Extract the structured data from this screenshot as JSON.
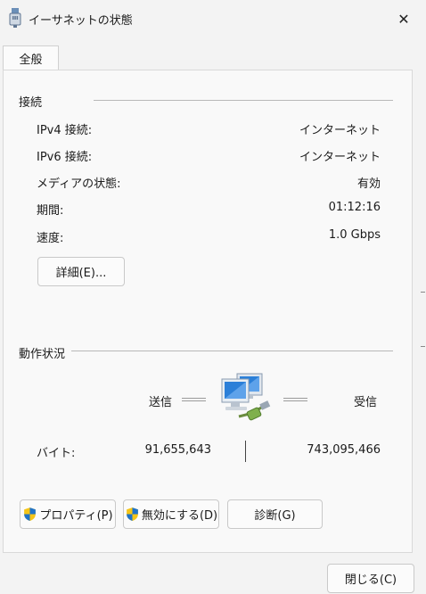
{
  "window": {
    "title": "イーサネットの状態",
    "close_glyph": "✕"
  },
  "tabs": [
    {
      "label": "全般",
      "selected": true
    }
  ],
  "connection": {
    "title": "接続",
    "rows": [
      {
        "label": "IPv4 接続:",
        "value": "インターネット"
      },
      {
        "label": "IPv6 接続:",
        "value": "インターネット"
      },
      {
        "label": "メディアの状態:",
        "value": "有効"
      },
      {
        "label": "期間:",
        "value": "01:12:16"
      },
      {
        "label": "速度:",
        "value": "1.0 Gbps"
      }
    ],
    "details_button": "詳細(E)..."
  },
  "activity": {
    "title": "動作状況",
    "sent_label": "送信",
    "received_label": "受信",
    "bytes_label": "バイト:",
    "bytes_sent": "91,655,643",
    "bytes_received": "743,095,466",
    "icon": "network-computers-icon"
  },
  "buttons": {
    "properties": "プロパティ(P)",
    "disable": "無効にする(D)",
    "diagnose": "診断(G)",
    "close": "閉じる(C)"
  },
  "icons": {
    "title": "ethernet-icon",
    "shield": "uac-shield-icon"
  },
  "colors": {
    "shield_blue": "#1f73c9",
    "shield_yellow": "#f5c518",
    "monitor_blue": "#2b7fd8"
  }
}
